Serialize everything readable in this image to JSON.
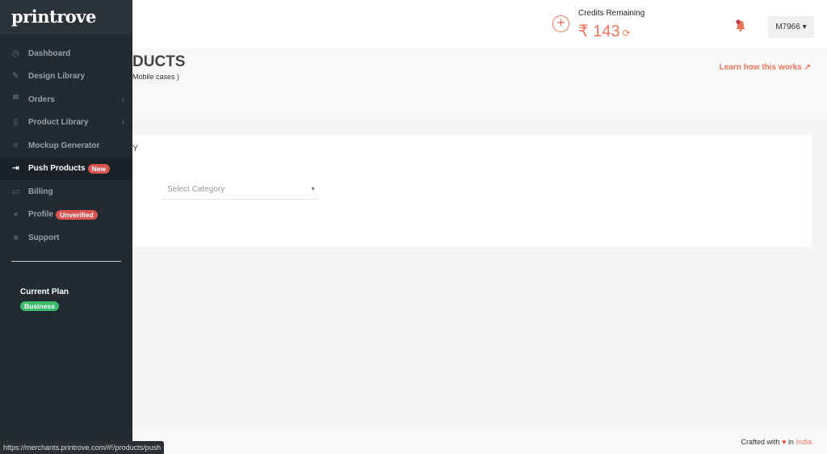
{
  "sidebar": {
    "logo": "printrove",
    "items": [
      {
        "label": "Dashboard",
        "icon": "dashboard-icon",
        "glyph": "◷"
      },
      {
        "label": "Design Library",
        "icon": "pencil-icon",
        "glyph": "✎"
      },
      {
        "label": "Orders",
        "icon": "bag-icon",
        "glyph": "▀",
        "chevron": "‹"
      },
      {
        "label": "Product Library",
        "icon": "tablet-icon",
        "glyph": "▯",
        "chevron": "‹"
      },
      {
        "label": "Mockup Generator",
        "icon": "crop-icon",
        "glyph": "⌗"
      },
      {
        "label": "Push Products",
        "icon": "sign-in-icon",
        "glyph": "⇥",
        "badge": "New",
        "active": true
      },
      {
        "label": "Billing",
        "icon": "credit-card-icon",
        "glyph": "▭"
      },
      {
        "label": "Profile",
        "icon": "user-icon",
        "glyph": "●",
        "badge": "Unverified"
      },
      {
        "label": "Support",
        "icon": "briefcase-icon",
        "glyph": "■"
      }
    ],
    "plan_label": "Current Plan",
    "plan_value": "Business"
  },
  "header": {
    "credits_label": "Credits Remaining",
    "credits_value": "₹ 143",
    "add_glyph": "+",
    "refresh_glyph": "⟳",
    "user_button": "M7966 ▾"
  },
  "page": {
    "title_visible": "DUCTS",
    "subtitle_visible": "Mobile cases )",
    "learn_link": "Learn how this works ↗",
    "card_label_visible": "Y",
    "select_placeholder": "Select Category",
    "select_caret": "▼"
  },
  "footer": {
    "crafted": "Crafted with",
    "heart": "♥",
    "in": "in",
    "country": "India"
  },
  "status_url": "https://merchants.printrove.com/#!/products/push",
  "colors": {
    "accent": "#f2735a",
    "sidebar": "#222b31",
    "badge_red": "#d9534f",
    "badge_green": "#3cba6b"
  }
}
